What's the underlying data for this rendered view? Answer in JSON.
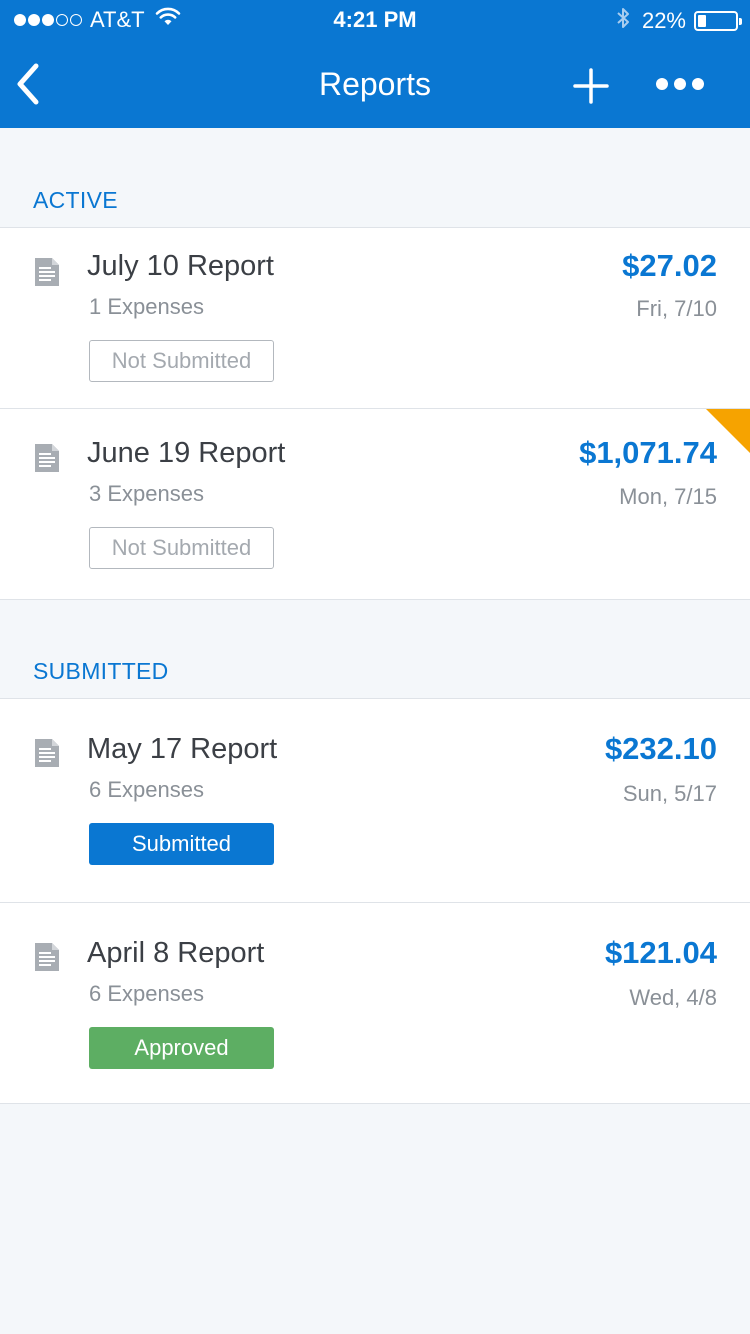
{
  "status_bar": {
    "carrier": "AT&T",
    "time": "4:21 PM",
    "battery_percent": "22%",
    "battery_level": 0.22,
    "signal_bars_filled": 3,
    "signal_bars_total": 5
  },
  "nav": {
    "title": "Reports",
    "back_icon": "chevron-left-icon",
    "add_icon": "plus-icon",
    "more_icon": "ellipsis-icon"
  },
  "colors": {
    "brand_blue": "#0a77d2",
    "approved_green": "#5dae63",
    "flag_orange": "#f6a300",
    "background": "#f4f7fa"
  },
  "sections": {
    "active": {
      "header": "ACTIVE",
      "reports": [
        {
          "title": "July 10 Report",
          "expenses": "1 Expenses",
          "amount": "$27.02",
          "date": "Fri, 7/10",
          "status": "Not Submitted",
          "flagged": false
        },
        {
          "title": "June 19 Report",
          "expenses": "3 Expenses",
          "amount": "$1,071.74",
          "date": "Mon, 7/15",
          "status": "Not Submitted",
          "flagged": true
        }
      ]
    },
    "submitted": {
      "header": "SUBMITTED",
      "reports": [
        {
          "title": "May 17 Report",
          "expenses": "6 Expenses",
          "amount": "$232.10",
          "date": "Sun, 5/17",
          "status": "Submitted",
          "flagged": false
        },
        {
          "title": "April 8 Report",
          "expenses": "6 Expenses",
          "amount": "$121.04",
          "date": "Wed, 4/8",
          "status": "Approved",
          "flagged": false
        }
      ]
    }
  }
}
